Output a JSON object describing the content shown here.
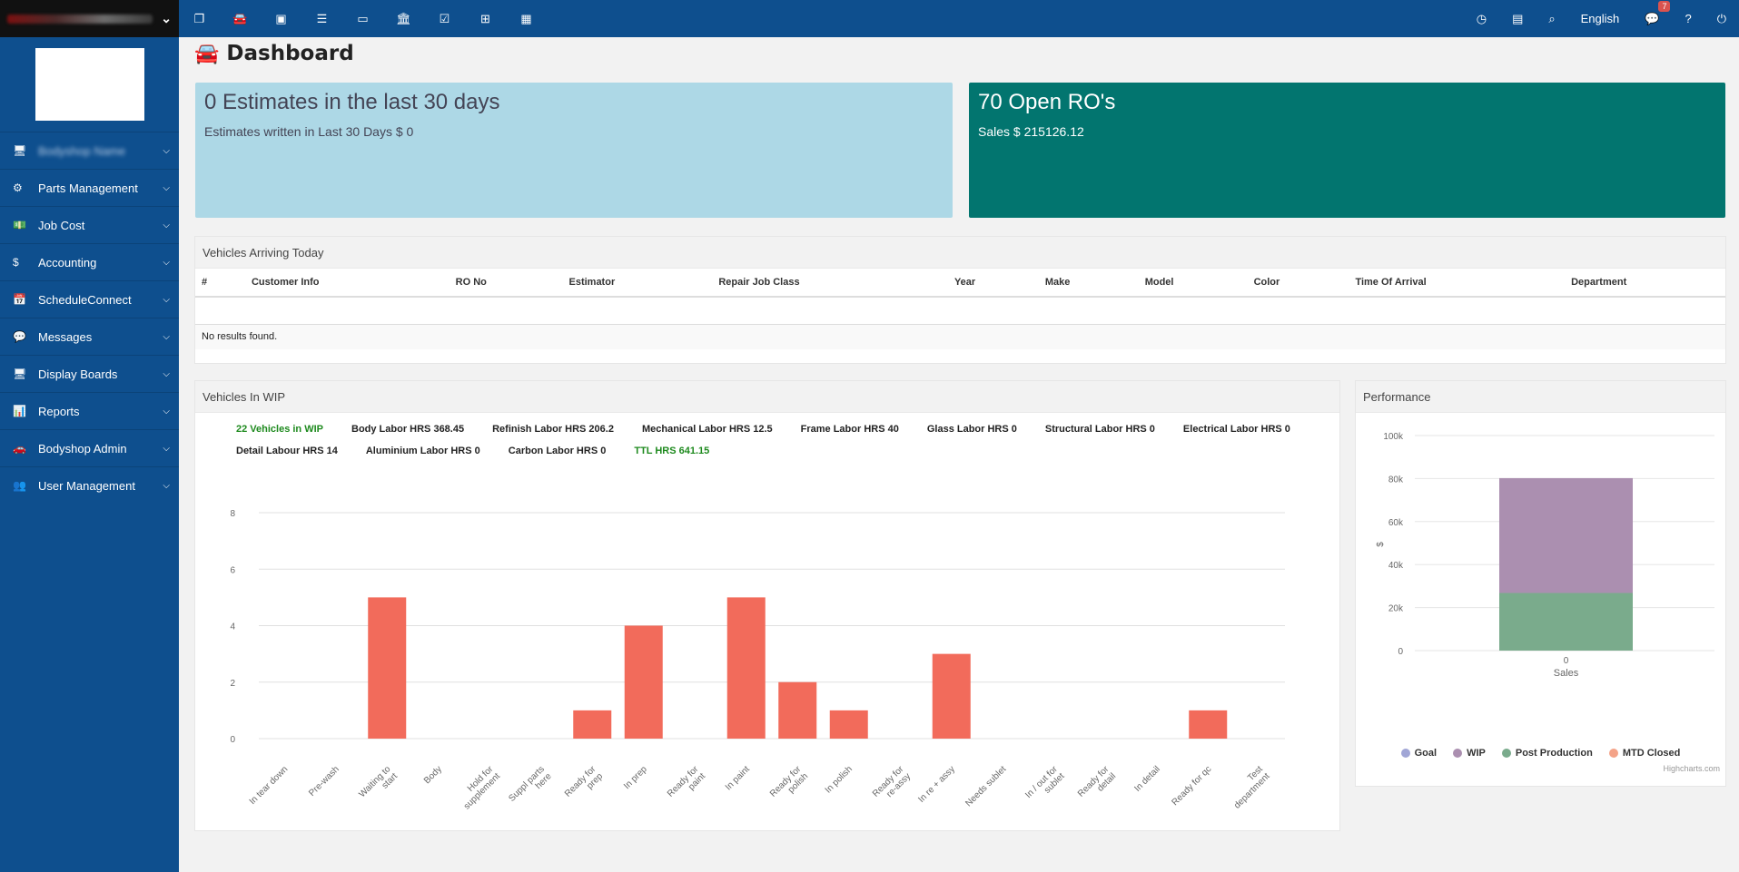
{
  "sidebar": {
    "items": [
      {
        "label": "Bodyshop Name",
        "icon": "monitor-icon",
        "glyph": "🖥"
      },
      {
        "label": "Parts Management",
        "icon": "cogs-icon",
        "glyph": "⚙"
      },
      {
        "label": "Job Cost",
        "icon": "money-icon",
        "glyph": "💵"
      },
      {
        "label": "Accounting",
        "icon": "dollar-icon",
        "glyph": "$"
      },
      {
        "label": "ScheduleConnect",
        "icon": "calendar-icon",
        "glyph": "📅"
      },
      {
        "label": "Messages",
        "icon": "comments-icon",
        "glyph": "💬"
      },
      {
        "label": "Display Boards",
        "icon": "monitor-icon",
        "glyph": "🖥"
      },
      {
        "label": "Reports",
        "icon": "chart-icon",
        "glyph": "📊"
      },
      {
        "label": "Bodyshop Admin",
        "icon": "car-icon",
        "glyph": "🚗"
      },
      {
        "label": "User Management",
        "icon": "users-icon",
        "glyph": "👥"
      }
    ]
  },
  "topbar": {
    "language": "English",
    "message_count": "7",
    "help": "?"
  },
  "page": {
    "title": "Dashboard"
  },
  "estimates_card": {
    "title": "0 Estimates in the last 30 days",
    "subtitle": "Estimates written in Last 30 Days $ 0"
  },
  "ro_card": {
    "title": "70 Open RO's",
    "subtitle": "Sales $ 215126.12"
  },
  "arriving": {
    "title": "Vehicles Arriving Today",
    "columns": [
      "#",
      "Customer Info",
      "RO No",
      "Estimator",
      "Repair Job Class",
      "Year",
      "Make",
      "Model",
      "Color",
      "Time Of Arrival",
      "Department"
    ],
    "empty_text": "No results found."
  },
  "wip": {
    "title": "Vehicles In WIP",
    "stats": [
      {
        "text": "22 Vehicles in WIP",
        "green": true
      },
      {
        "text": "Body Labor HRS 368.45",
        "green": false
      },
      {
        "text": "Refinish Labor HRS 206.2",
        "green": false
      },
      {
        "text": "Mechanical Labor HRS 12.5",
        "green": false
      },
      {
        "text": "Frame Labor HRS 40",
        "green": false
      },
      {
        "text": "Glass Labor HRS 0",
        "green": false
      },
      {
        "text": "Structural Labor HRS 0",
        "green": false
      },
      {
        "text": "Electrical Labor HRS 0",
        "green": false
      },
      {
        "text": "Detail Labour HRS 14",
        "green": false
      },
      {
        "text": "Aluminium Labor HRS 0",
        "green": false
      },
      {
        "text": "Carbon Labor HRS 0",
        "green": false
      },
      {
        "text": "TTL HRS 641.15",
        "green": true
      }
    ]
  },
  "performance": {
    "title": "Performance",
    "credit": "Highcharts.com"
  },
  "chart_data": [
    {
      "type": "bar",
      "categories": [
        "In tear down",
        "Pre-wash",
        "Waiting to start",
        "Body",
        "Hold for supplement",
        "Suppl parts here",
        "Ready for prep",
        "In prep",
        "Ready for paint",
        "In paint",
        "Ready for polish",
        "In polish",
        "Ready for re-assy",
        "In re + assy",
        "Needs sublet",
        "In / out for sublet",
        "Ready for detail",
        "In detail",
        "Ready for qc",
        "Test department"
      ],
      "values": [
        0,
        0,
        5,
        0,
        0,
        0,
        1,
        4,
        0,
        5,
        2,
        1,
        0,
        3,
        0,
        0,
        0,
        0,
        1,
        0
      ],
      "yticks": [
        "0",
        "2",
        "4",
        "6",
        "8"
      ],
      "ylim": [
        0,
        8
      ],
      "color": "#f26b5b",
      "grid": true
    },
    {
      "type": "bar",
      "stacked": true,
      "categories": [
        "0"
      ],
      "xlabel": "Sales",
      "ylabel": "$",
      "yticks": [
        "0",
        "20k",
        "40k",
        "60k",
        "80k",
        "100k"
      ],
      "ylim": [
        0,
        100000
      ],
      "series": [
        {
          "name": "Goal",
          "values": [
            0
          ],
          "color": "#a1a6d6"
        },
        {
          "name": "WIP",
          "values": [
            53400
          ],
          "color": "#ab8fb0"
        },
        {
          "name": "Post Production",
          "values": [
            26800
          ],
          "color": "#7aab8c"
        },
        {
          "name": "MTD Closed",
          "values": [
            0
          ],
          "color": "#f4a388"
        }
      ],
      "legend": "bottom"
    }
  ]
}
